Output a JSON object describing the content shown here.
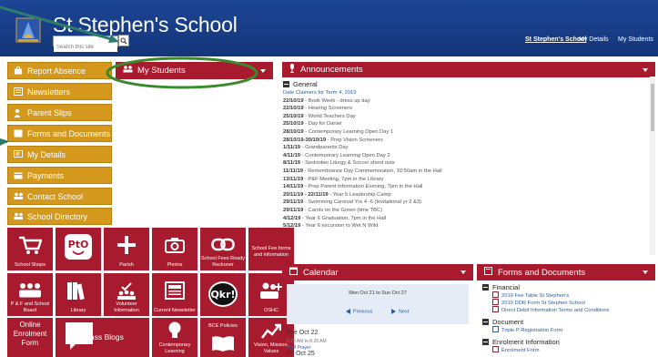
{
  "header": {
    "school_name": "St Stephen's School",
    "search_placeholder": "Search this site",
    "links": [
      "St Stephen's School",
      "My Details",
      "My Students"
    ]
  },
  "left_nav": [
    {
      "label": "Report Absence",
      "icon": "briefcase-icon"
    },
    {
      "label": "Newsletters",
      "icon": "newspaper-icon"
    },
    {
      "label": "Parent Slips",
      "icon": "person-icon"
    },
    {
      "label": "Forms and Documents",
      "icon": "folder-icon"
    },
    {
      "label": "My Details",
      "icon": "id-card-icon"
    },
    {
      "label": "Payments",
      "icon": "credit-card-icon"
    },
    {
      "label": "Contact School",
      "icon": "group-icon"
    },
    {
      "label": "School Directory",
      "icon": "group-icon"
    }
  ],
  "tiles": [
    {
      "label": "School Shops",
      "icon": "cart-icon"
    },
    {
      "label": "",
      "icon": "pto-logo-icon"
    },
    {
      "label": "Parish",
      "icon": "cross-icon"
    },
    {
      "label": "Photos",
      "icon": "camera-icon"
    },
    {
      "label": "School Fees Ready Reckoner",
      "icon": "link-icon"
    },
    {
      "label": "School Fee forms and information",
      "icon": ""
    },
    {
      "label": "P & F and School Board",
      "icon": "people-icon"
    },
    {
      "label": "Library",
      "icon": "books-icon"
    },
    {
      "label": "Volunteer Information",
      "icon": "volunteer-icon"
    },
    {
      "label": "Current Newsletter",
      "icon": "newspaper-icon"
    },
    {
      "label": "",
      "icon": "qkr-logo-icon"
    },
    {
      "label": "OSHC",
      "icon": "add-group-icon"
    },
    {
      "label": "Online Enrolment Form",
      "icon": ""
    },
    {
      "label": "Class Blogs",
      "icon": "speech-bubble-icon"
    },
    {
      "label": "Contemporary Learning",
      "icon": "lightbulb-icon"
    },
    {
      "label": "BCE Policies",
      "icon": "book-icon"
    },
    {
      "label": "Vision, Mission, Values",
      "icon": "chart-icon"
    }
  ],
  "my_students": {
    "title": "My Students"
  },
  "announcements": {
    "title": "Announcements",
    "group": "General",
    "subtitle": "Date Claimers for Term 4, 2019",
    "items": [
      {
        "date": "22/10/19",
        "text": " - Book Week - dress up day"
      },
      {
        "date": "22/10/19",
        "text": " - Hearing Screeners"
      },
      {
        "date": "25/10/19",
        "text": " - World Teachers Day"
      },
      {
        "date": "25/10/19",
        "text": " - Day for Daniel"
      },
      {
        "date": "28/10/19",
        "text": " - Contemporary Learning Open Day 1"
      },
      {
        "date": "28/10/19-30/10/19",
        "text": " - Prep Vision Screeners"
      },
      {
        "date": "1/11/19",
        "text": " - Grandparents Day"
      },
      {
        "date": "4/11/19",
        "text": " - Contemporary Learning Open Day 2"
      },
      {
        "date": "8/11/19",
        "text": " - Socktober Liturgy & Soccer shoot outs"
      },
      {
        "date": "11/11/19",
        "text": " - Remembrance Day Commemoration, 10:50am in the Hall"
      },
      {
        "date": "13/11/19",
        "text": " - P&F Meeting, 7pm in the Library"
      },
      {
        "date": "14/11/19",
        "text": " - Prep Parent Information Evening, 7pm in the Hall"
      },
      {
        "date": "20/11/19 - 22/11/19",
        "text": " - Year 5 Leadership Camp"
      },
      {
        "date": "29/11/19",
        "text": " - Swimming Carnival Yrs 4 -6 (Invitational yr 2 &3)"
      },
      {
        "date": "29/11/19",
        "text": " - Carols on the Green (time TBC)"
      },
      {
        "date": "4/12/19",
        "text": " - Year 6 Graduation, 7pm in the Hall"
      },
      {
        "date": "5/12/19",
        "text": " - Year 6 excursion to Wet N Wild"
      }
    ]
  },
  "calendar": {
    "title": "Calendar",
    "range": "Mon Oct 21 to Sun Oct 27",
    "previous": "Previous",
    "next": "Next",
    "events": [
      {
        "day": "Tue Oct 22",
        "time": "8:15 AM to 8:20 AM",
        "name": "Staff Prayer"
      },
      {
        "day": "Fri Oct 25",
        "time": "",
        "name": ""
      }
    ]
  },
  "forms": {
    "title": "Forms and Documents",
    "groups": [
      {
        "name": "Financial",
        "items": [
          "2019 Fee Table St Stephen's",
          "2019 DDR Form St Stephen School",
          "Direct Debit Information Terms and Conditions"
        ]
      },
      {
        "name": "Document",
        "items": [
          "Triple P Registration Form"
        ]
      },
      {
        "name": "Enrolment Information",
        "items": [
          "Enrolment Form"
        ]
      }
    ]
  },
  "colors": {
    "header": "#1a3f8f",
    "nav": "#d4991c",
    "accent": "#a81a2e",
    "arrow": "#2e7d6b",
    "highlight_ring": "#3a8a2e"
  }
}
